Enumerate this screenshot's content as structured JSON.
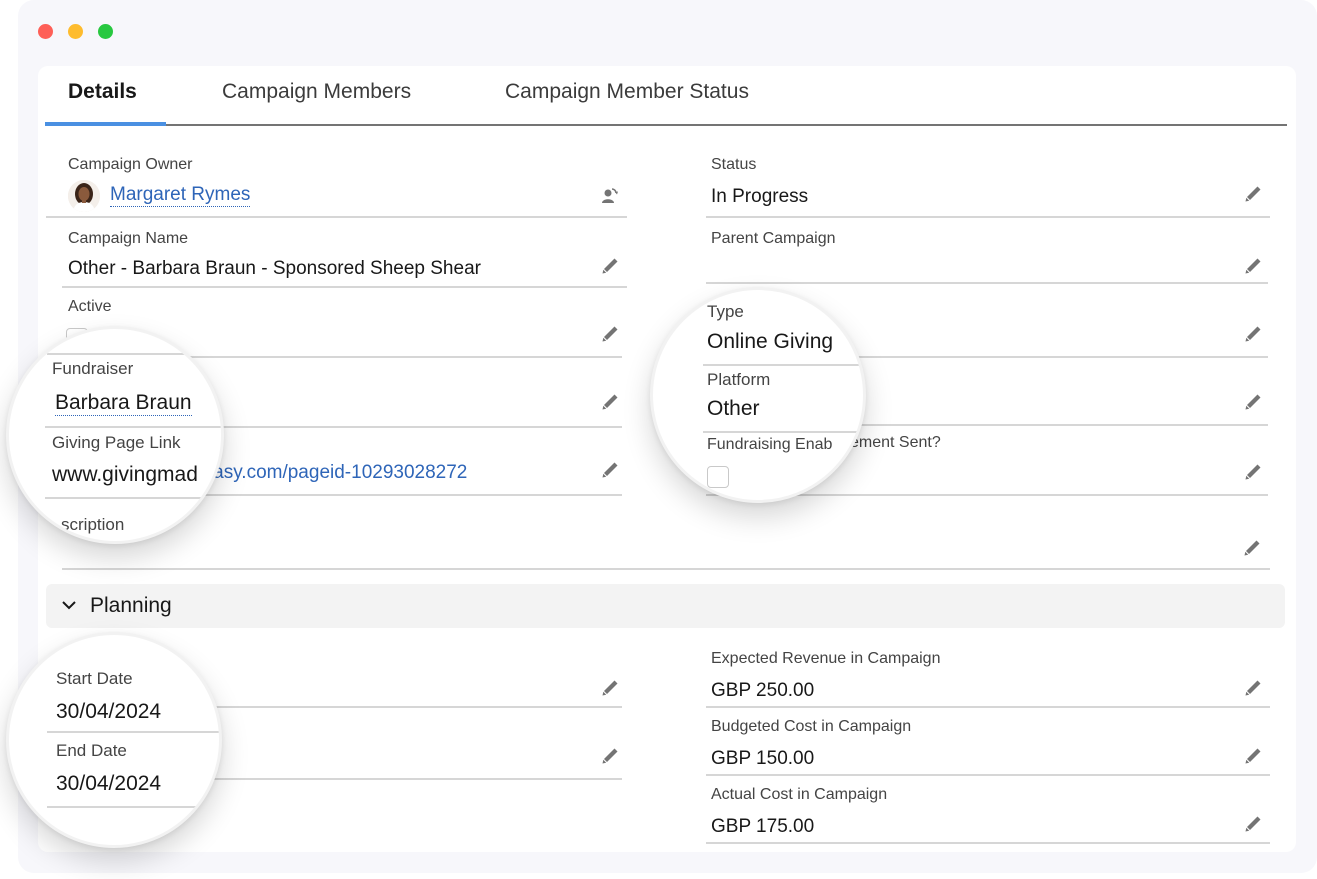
{
  "window": {
    "controls": [
      "close",
      "minimize",
      "maximize"
    ]
  },
  "tabs": [
    {
      "label": "Details",
      "active": true
    },
    {
      "label": "Campaign Members",
      "active": false
    },
    {
      "label": "Campaign Member Status",
      "active": false
    }
  ],
  "details": {
    "left": {
      "campaign_owner": {
        "label": "Campaign Owner",
        "value": "Margaret Rymes",
        "action_icon": "change-owner-icon"
      },
      "campaign_name": {
        "label": "Campaign Name",
        "value": "Other - Barbara Braun - Sponsored Sheep Shear"
      },
      "active": {
        "label": "Active",
        "checked": false
      },
      "fundraiser": {
        "label": "Fundraiser",
        "value": "Barbara Braun"
      },
      "giving_page_link": {
        "label": "Giving Page Link",
        "value": "www.givingmadeeasy.com/pageid-10293028272",
        "value_prefix": "www.givingmad",
        "value_suffix": "eeasy.com/pageid-10293028272"
      },
      "description": {
        "label": "Description",
        "label_visible": "scription",
        "value": ""
      }
    },
    "right": {
      "status": {
        "label": "Status",
        "value": "In Progress"
      },
      "parent_campaign": {
        "label": "Parent Campaign",
        "value": ""
      },
      "type": {
        "label": "Type",
        "value": "Online Giving"
      },
      "platform": {
        "label": "Platform",
        "value": "Other"
      },
      "fundraising_enablement_sent": {
        "label": "Fundraising Enablement Sent?",
        "label_prefix": "Fundraising Enab",
        "label_suffix": "ement Sent?",
        "checked": false
      }
    }
  },
  "planning": {
    "section_title": "Planning",
    "expanded": true,
    "left": {
      "start_date": {
        "label": "Start Date",
        "value": "30/04/2024"
      },
      "end_date": {
        "label": "End Date",
        "value": "30/04/2024"
      }
    },
    "right": {
      "expected_revenue": {
        "label": "Expected Revenue in Campaign",
        "value": "GBP 250.00"
      },
      "budgeted_cost": {
        "label": "Budgeted Cost in Campaign",
        "value": "GBP 150.00"
      },
      "actual_cost": {
        "label": "Actual Cost in Campaign",
        "value": "GBP 175.00"
      }
    }
  },
  "colors": {
    "link": "#2e65b8",
    "tab_indicator": "#4a90e2",
    "traffic_red": "#fe5f57",
    "traffic_yellow": "#febc2e",
    "traffic_green": "#28c840"
  }
}
